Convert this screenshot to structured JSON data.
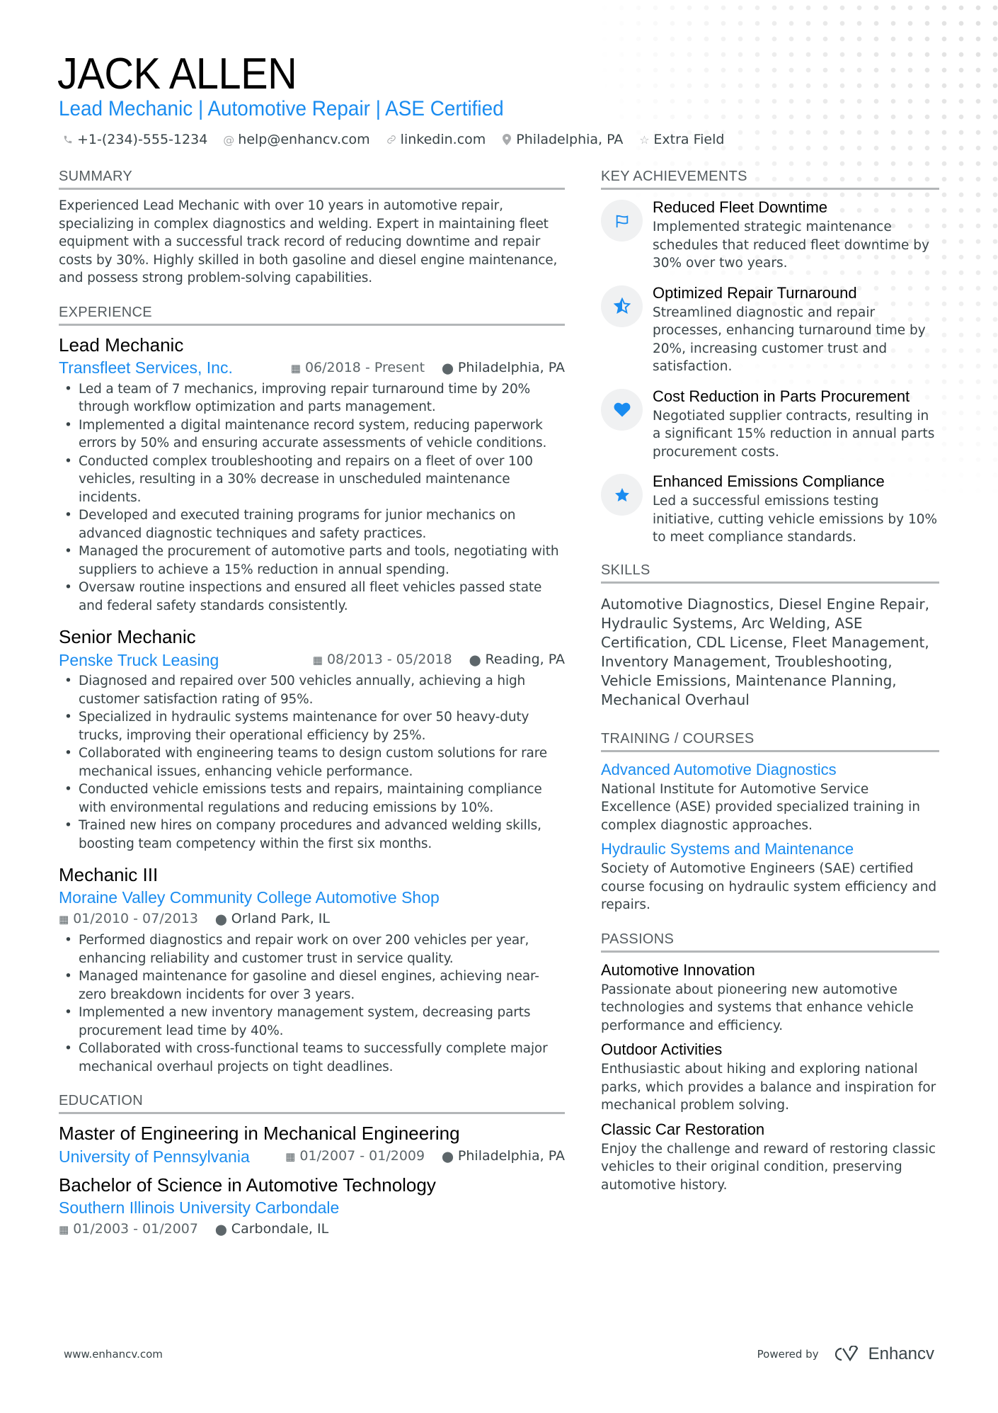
{
  "header": {
    "name": "JACK ALLEN",
    "headline": "Lead Mechanic | Automotive Repair | ASE Certified",
    "contacts": [
      {
        "icon": "phone-icon",
        "value": "+1-(234)-555-1234"
      },
      {
        "icon": "at-icon",
        "value": "help@enhancv.com"
      },
      {
        "icon": "link-icon",
        "value": "linkedin.com"
      },
      {
        "icon": "location-icon",
        "value": "Philadelphia, PA"
      },
      {
        "icon": "star-icon",
        "value": "Extra Field"
      }
    ]
  },
  "summary": {
    "title": "SUMMARY",
    "text": "Experienced Lead Mechanic with over 10 years in automotive repair, specializing in complex diagnostics and welding. Expert in maintaining fleet equipment with a successful track record of reducing downtime and repair costs by 30%. Highly skilled in both gasoline and diesel engine maintenance, and possess strong problem-solving capabilities."
  },
  "experience": {
    "title": "EXPERIENCE",
    "jobs": [
      {
        "title": "Lead Mechanic",
        "company": "Transfleet Services, Inc.",
        "dates": "06/2018 - Present",
        "location": "Philadelphia, PA",
        "bullets": [
          "Led a team of 7 mechanics, improving repair turnaround time by 20% through workflow optimization and parts management.",
          "Implemented a digital maintenance record system, reducing paperwork errors by 50% and ensuring accurate assessments of vehicle conditions.",
          "Conducted complex troubleshooting and repairs on a fleet of over 100 vehicles, resulting in a 30% decrease in unscheduled maintenance incidents.",
          "Developed and executed training programs for junior mechanics on advanced diagnostic techniques and safety practices.",
          "Managed the procurement of automotive parts and tools, negotiating with suppliers to achieve a 15% reduction in annual spending.",
          "Oversaw routine inspections and ensured all fleet vehicles passed state and federal safety standards consistently."
        ]
      },
      {
        "title": "Senior Mechanic",
        "company": "Penske Truck Leasing",
        "dates": "08/2013 - 05/2018",
        "location": "Reading, PA",
        "bullets": [
          "Diagnosed and repaired over 500 vehicles annually, achieving a high customer satisfaction rating of 95%.",
          "Specialized in hydraulic systems maintenance for over 50 heavy-duty trucks, improving their operational efficiency by 25%.",
          "Collaborated with engineering teams to design custom solutions for rare mechanical issues, enhancing vehicle performance.",
          "Conducted vehicle emissions tests and repairs, maintaining compliance with environmental regulations and reducing emissions by 10%.",
          "Trained new hires on company procedures and advanced welding skills, boosting team competency within the first six months."
        ]
      },
      {
        "title": "Mechanic III",
        "company": "Moraine Valley Community College Automotive Shop",
        "dates": "01/2010 - 07/2013",
        "location": "Orland Park, IL",
        "bullets": [
          "Performed diagnostics and repair work on over 200 vehicles per year, enhancing reliability and customer trust in service quality.",
          "Managed maintenance for gasoline and diesel engines, achieving near-zero breakdown incidents for over 3 years.",
          "Implemented a new inventory management system, decreasing parts procurement lead time by 40%.",
          "Collaborated with cross-functional teams to successfully complete major mechanical overhaul projects on tight deadlines."
        ]
      }
    ]
  },
  "education": {
    "title": "EDUCATION",
    "items": [
      {
        "degree": "Master of Engineering in Mechanical Engineering",
        "school": "University of Pennsylvania",
        "dates": "01/2007 - 01/2009",
        "location": "Philadelphia, PA"
      },
      {
        "degree": "Bachelor of Science in Automotive Technology",
        "school": "Southern Illinois University Carbondale",
        "dates": "01/2003 - 01/2007",
        "location": "Carbondale, IL"
      }
    ]
  },
  "achievements": {
    "title": "KEY ACHIEVEMENTS",
    "items": [
      {
        "icon": "flag-icon",
        "title": "Reduced Fleet Downtime",
        "desc": "Implemented strategic maintenance schedules that reduced fleet downtime by 30% over two years."
      },
      {
        "icon": "half-star-icon",
        "title": "Optimized Repair Turnaround",
        "desc": "Streamlined diagnostic and repair processes, enhancing turnaround time by 20%, increasing customer trust and satisfaction."
      },
      {
        "icon": "heart-icon",
        "title": "Cost Reduction in Parts Procurement",
        "desc": "Negotiated supplier contracts, resulting in a significant 15% reduction in annual parts procurement costs."
      },
      {
        "icon": "star-icon",
        "title": "Enhanced Emissions Compliance",
        "desc": "Led a successful emissions testing initiative, cutting vehicle emissions by 10% to meet compliance standards."
      }
    ]
  },
  "skills": {
    "title": "SKILLS",
    "text": "Automotive Diagnostics, Diesel Engine Repair, Hydraulic Systems, Arc Welding, ASE Certification, CDL License, Fleet Management, Inventory Management, Troubleshooting, Vehicle Emissions, Maintenance Planning, Mechanical Overhaul"
  },
  "training": {
    "title": "TRAINING / COURSES",
    "items": [
      {
        "title": "Advanced Automotive Diagnostics",
        "desc": "National Institute for Automotive Service Excellence (ASE) provided specialized training in complex diagnostic approaches."
      },
      {
        "title": "Hydraulic Systems and Maintenance",
        "desc": "Society of Automotive Engineers (SAE) certified course focusing on hydraulic system efficiency and repairs."
      }
    ]
  },
  "passions": {
    "title": "PASSIONS",
    "items": [
      {
        "title": "Automotive Innovation",
        "desc": "Passionate about pioneering new automotive technologies and systems that enhance vehicle performance and efficiency."
      },
      {
        "title": "Outdoor Activities",
        "desc": "Enthusiastic about hiking and exploring national parks, which provides a balance and inspiration for mechanical problem solving."
      },
      {
        "title": "Classic Car Restoration",
        "desc": "Enjoy the challenge and reward of restoring classic vehicles to their original condition, preserving automotive history."
      }
    ]
  },
  "footer": {
    "website": "www.enhancv.com",
    "powered_by": "Powered by",
    "brand": "Enhancv"
  },
  "colors": {
    "accent": "#1a8cf0",
    "text": "#384347",
    "heading": "#000000",
    "rule": "#b3b6b8",
    "icon_bg": "#f0f1f2"
  }
}
